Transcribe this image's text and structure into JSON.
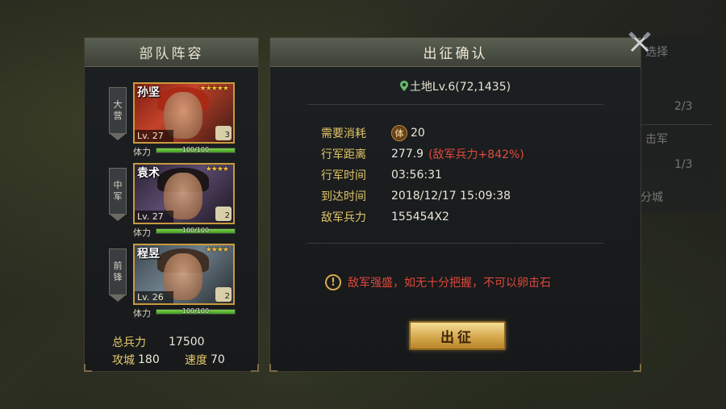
{
  "background_ghost": {
    "items": [
      "选择",
      "分城",
      "2/3",
      "击军",
      "1/3",
      "分城"
    ]
  },
  "left_panel": {
    "title": "部队阵容",
    "slots": [
      {
        "banner_line1": "大",
        "banner_line2": "营",
        "name": "孙坚",
        "stars": "★★★★★",
        "level": "Lv. 27",
        "badge": "3",
        "stamina_label": "体力",
        "stamina_text": "100/100",
        "stamina": 1.0
      },
      {
        "banner_line1": "中",
        "banner_line2": "军",
        "name": "袁术",
        "stars": "★★★★",
        "level": "Lv. 27",
        "badge": "2",
        "stamina_label": "体力",
        "stamina_text": "100/100",
        "stamina": 1.0
      },
      {
        "banner_line1": "前",
        "banner_line2": "锋",
        "name": "程昱",
        "stars": "★★★★",
        "level": "Lv. 26",
        "badge": "2",
        "stamina_label": "体力",
        "stamina_text": "100/100",
        "stamina": 1.0
      }
    ],
    "stats": {
      "troops_label": "总兵力",
      "troops_value": "17500",
      "siege_label": "攻城",
      "siege_value": "180",
      "speed_label": "速度",
      "speed_value": "70"
    }
  },
  "dialog": {
    "title": "出征确认",
    "location": "土地Lv.6(72,1435)",
    "rows": [
      {
        "label": "需要消耗",
        "icon_char": "体",
        "value": "20"
      },
      {
        "label": "行军距离",
        "value": "277.9",
        "note": "(敌军兵力+842%)"
      },
      {
        "label": "行军时间",
        "value": "03:56:31"
      },
      {
        "label": "到达时间",
        "value": "2018/12/17 15:09:38"
      },
      {
        "label": "敌军兵力",
        "value": "155454X2"
      }
    ],
    "warning": "敌军强盛，如无十分把握，不可以卵击石",
    "warning_icon": "!",
    "confirm_label": "出征"
  },
  "colors": {
    "accent_gold": "#e0c465",
    "warning_red": "#e04a3c",
    "stamina_green": "#6cc23a"
  },
  "icons": [
    "pin-icon",
    "stamina-icon",
    "warning-icon",
    "close-icon"
  ]
}
